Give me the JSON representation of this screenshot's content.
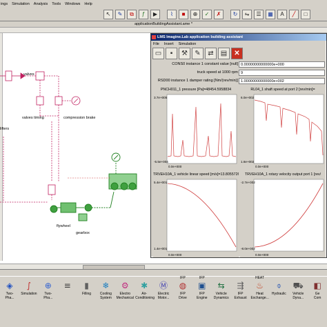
{
  "menu": {
    "items": [
      "ings",
      "Simulation",
      "Analysis",
      "Tools",
      "Windows",
      "Help"
    ]
  },
  "canvas": {
    "title": "applicationBuildingAssistant.ame *",
    "labels": {
      "valves": "valves",
      "valves_timing": "valves timing",
      "compression_brake": "compression brake",
      "lifters": "lifters",
      "flywheel": "flywheel",
      "gearbox": "gearbox"
    }
  },
  "assistant": {
    "title": "LMS Imagine.Lab application building assistant",
    "menu": [
      "File",
      "Insert",
      "Simulation"
    ],
    "params": [
      {
        "label": "CONS0 instance 1 constant value [null]",
        "value": "0.00000000000000e+000"
      },
      {
        "label": "truck speed at 1000 rpm",
        "value": "9"
      },
      {
        "label": "RSD00 instance 1 damper rating [Nm/(rev/min)]",
        "value": "1.00000000000000e+002"
      }
    ],
    "plots": [
      {
        "title": "PNCH011_1 pressure [Pa]=48454.5958834",
        "y_top": "3.7e+005",
        "y_bottom": "-5.5e+004",
        "x_left": "0.0e+000"
      },
      {
        "title": "RL04_1 shaft speed at port 2 [rev/min]=",
        "y_top": "6.0e+002",
        "y_bottom": "1.6e+002",
        "x_left": "0.0e+000"
      },
      {
        "title": "TRVEH10A_1 vehicle linear speed [m/s]=13.8055726836",
        "y_top": "5.4e+001",
        "y_bottom": "1.4e+001",
        "x_left": "0.0e+000"
      },
      {
        "title": "TRVEH10A_1 rotary velocity output port 1 [rev/",
        "y_top": "-2.7e+002",
        "y_bottom": "-8.0e+002",
        "x_left": "0.0e+000"
      }
    ]
  },
  "palette": {
    "items": [
      {
        "label": "Two-\nPha...",
        "icon": "two-phase-icon",
        "glyph": "◈",
        "color": "#2050c0"
      },
      {
        "label": "Simulation",
        "icon": "simulation-icon",
        "glyph": "∫",
        "color": "#c03030"
      },
      {
        "label": "Two-\nPha...",
        "icon": "two-phase-icon",
        "glyph": "⊕",
        "color": "#3060d0"
      },
      {
        "label": "",
        "icon": "pipe-icon",
        "glyph": "≡",
        "color": "#404040"
      },
      {
        "label": "Filling",
        "icon": "filling-icon",
        "glyph": "▮",
        "color": "#606060"
      },
      {
        "label": "Cooling\nSystem",
        "icon": "cooling-icon",
        "glyph": "❄",
        "color": "#2080c0"
      },
      {
        "label": "Electro\nMechanical",
        "icon": "electro-mechanical-icon",
        "glyph": "⚙",
        "color": "#c03080"
      },
      {
        "label": "Air-\nConditioning",
        "icon": "air-conditioning-icon",
        "glyph": "✱",
        "color": "#30a0a0"
      },
      {
        "label": "Electric\nMotor...",
        "icon": "electric-motor-icon",
        "glyph": "Ⓜ",
        "color": "#4040b0"
      },
      {
        "label": "IFP\nDrive",
        "icon": "ifp-drive-icon",
        "glyph": "◍",
        "color": "#b03030"
      },
      {
        "label": "IFP\nEngine",
        "icon": "ifp-engine-icon",
        "glyph": "▣",
        "color": "#205090"
      },
      {
        "label": "Vehicle\nDynamics",
        "icon": "vehicle-dynamics-icon",
        "glyph": "⇆",
        "color": "#207040"
      },
      {
        "label": "IFP\nExhaust",
        "icon": "ifp-exhaust-icon",
        "glyph": "⇶",
        "color": "#606060"
      },
      {
        "label": "Heat\nExchange...",
        "icon": "heat-exchange-icon",
        "glyph": "♨",
        "color": "#c04020"
      },
      {
        "label": "Hydraulic",
        "icon": "hydraulic-icon",
        "glyph": "⌽",
        "color": "#2050b0"
      },
      {
        "label": "Vehicle\nDyna...",
        "icon": "vehicle-dyna-icon",
        "glyph": "⛟",
        "color": "#505050"
      },
      {
        "label": "Ge\nCom",
        "icon": "general-component-icon",
        "glyph": "◧",
        "color": "#803030"
      }
    ],
    "sublabels": [
      "IFP",
      "IFP",
      "HEAT"
    ]
  }
}
